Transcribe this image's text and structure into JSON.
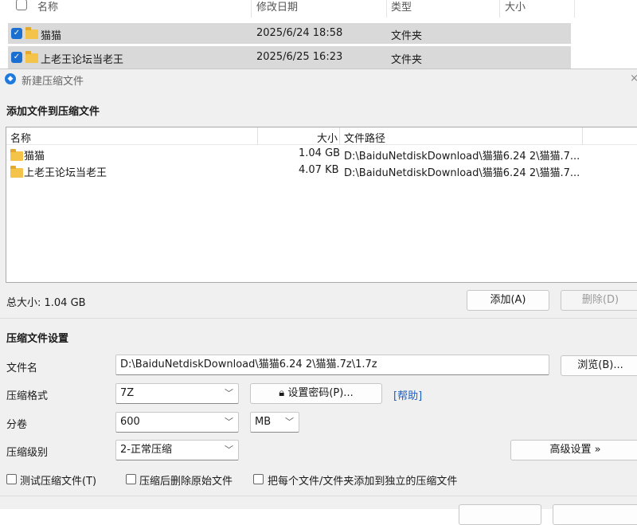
{
  "explorer": {
    "headers": {
      "name": "名称",
      "modified": "修改日期",
      "type": "类型",
      "size": "大小"
    },
    "rows": [
      {
        "name": "猫猫",
        "modified": "2025/6/24 18:58",
        "type": "文件夹"
      },
      {
        "name": "上老王论坛当老王",
        "modified": "2025/6/25 16:23",
        "type": "文件夹"
      }
    ]
  },
  "dialog": {
    "title": "新建压缩文件",
    "close_icon": "×",
    "section_add": "添加文件到压缩文件",
    "list_headers": {
      "name": "名称",
      "size": "大小",
      "path": "文件路径"
    },
    "files": [
      {
        "name": "猫猫",
        "size": "1.04 GB",
        "path": "D:\\BaiduNetdiskDownload\\猫猫6.24 2\\猫猫.7..."
      },
      {
        "name": "上老王论坛当老王",
        "size": "4.07 KB",
        "path": "D:\\BaiduNetdiskDownload\\猫猫6.24 2\\猫猫.7..."
      }
    ],
    "total_size": "总大小: 1.04 GB",
    "add_button": "添加(A)",
    "delete_button": "删除(D)",
    "section_settings": "压缩文件设置",
    "filename_label": "文件名",
    "filename_value": "D:\\BaiduNetdiskDownload\\猫猫6.24 2\\猫猫.7z\\1.7z",
    "browse_button": "浏览(B)...",
    "format_label": "压缩格式",
    "format_value": "7Z",
    "password_button": "设置密码(P)...",
    "help_link": "[帮助]",
    "split_label": "分卷",
    "split_value": "600",
    "split_unit": "MB",
    "level_label": "压缩级别",
    "level_value": "2-正常压缩",
    "advanced_button": "高级设置 »",
    "opt_test": "测试压缩文件(T)",
    "opt_delete": "压缩后删除原始文件",
    "opt_each": "把每个文件/文件夹添加到独立的压缩文件"
  }
}
